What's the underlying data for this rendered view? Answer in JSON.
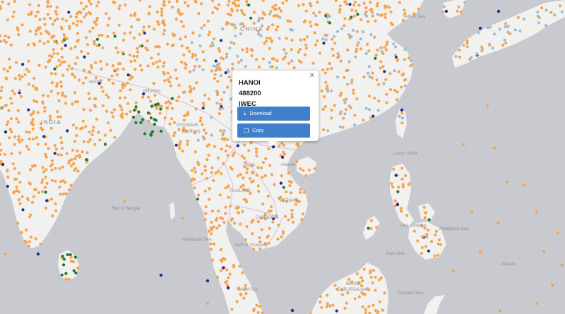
{
  "map": {
    "colors": {
      "sea": "#c9cacf",
      "land": "#f1f1ef",
      "border": "#d9bfd8",
      "station_orange": "#f5a34f",
      "station_blue": "#9dbcd6",
      "station_green": "#1b7a2d",
      "station_navy": "#242a8a"
    },
    "labels": {
      "china": "CHINA",
      "india": "INDIA",
      "nepal": "NEPAL",
      "bhutan": "BHUTAN",
      "myanmar": "MYANMAR",
      "burma": "(BURMA)",
      "laos": "LAOS",
      "thailand": "THAILAND",
      "vietnam": "VIETNAM",
      "cambodia": "CAMBODIA",
      "philippines": "PHILIPPINES",
      "palau": "PALAU",
      "brunei": "BRUNEI",
      "darussalam": "DARUSSALAM",
      "malaysia": "MALAYSIA",
      "yellow_sea": "Yellow Sea",
      "bay_of_bengal": "Bay of Bengal",
      "andaman_sea": "Andaman Sea",
      "gulf_of_thailand": "Gulf of Thailand",
      "sulu_sea": "Sulu Sea",
      "celebes_sea": "Celebes Sea",
      "luzon_strait": "Luzon Strait",
      "philippine_sea": "Philippine Sea",
      "hainan": "Hainan"
    }
  },
  "popup": {
    "city": "HANOI",
    "station_id": "488200",
    "source": "IWEC",
    "download_label": "Download",
    "copy_label": "Copy",
    "download_icon": "download-icon",
    "copy_icon": "copy-icon",
    "close_icon": "close-icon"
  }
}
